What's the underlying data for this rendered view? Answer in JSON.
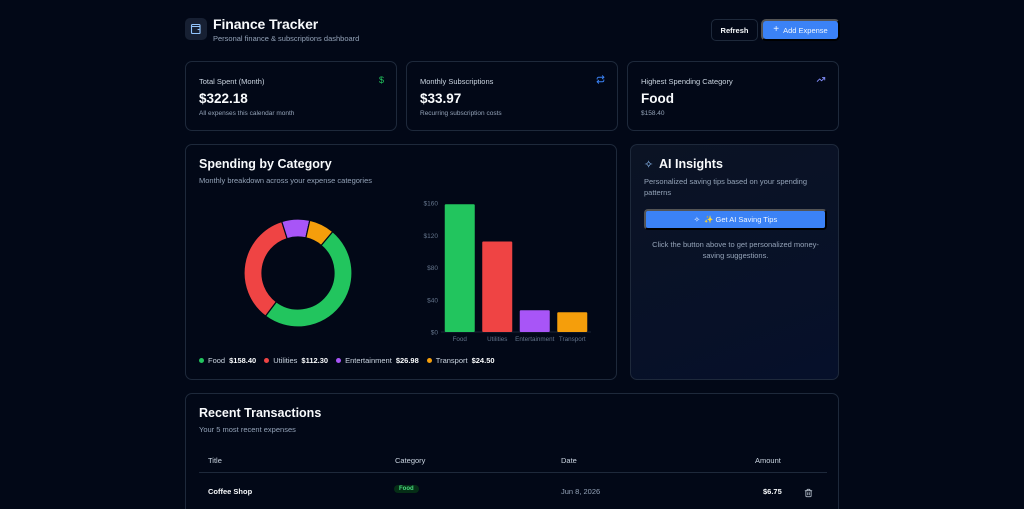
{
  "header": {
    "title": "Finance Tracker",
    "subtitle": "Personal finance & subscriptions dashboard",
    "refresh_label": "Refresh",
    "add_label": "Add Expense"
  },
  "stats": [
    {
      "label": "Total Spent (Month)",
      "value": "$322.18",
      "note": "All expenses this calendar month",
      "icon": "dollar-icon",
      "color": "#22c55e"
    },
    {
      "label": "Monthly Subscriptions",
      "value": "$33.97",
      "note": "Recurring subscription costs",
      "icon": "repeat-icon",
      "color": "#3b82f6"
    },
    {
      "label": "Highest Spending Category",
      "value": "Food",
      "note": "$158.40",
      "icon": "trending-up-icon",
      "color": "#818cf8"
    }
  ],
  "spending": {
    "title": "Spending by Category",
    "subtitle": "Monthly breakdown across your expense categories"
  },
  "chart_data": [
    {
      "type": "pie",
      "categories": [
        "Food",
        "Utilities",
        "Entertainment",
        "Transport"
      ],
      "values": [
        158.4,
        112.3,
        26.98,
        24.5
      ],
      "colors": [
        "#22c55e",
        "#ef4444",
        "#a855f7",
        "#f59e0b"
      ]
    },
    {
      "type": "bar",
      "categories": [
        "Food",
        "Utilities",
        "Entertainment",
        "Transport"
      ],
      "values": [
        158.4,
        112.3,
        26.98,
        24.5
      ],
      "colors": [
        "#22c55e",
        "#ef4444",
        "#a855f7",
        "#f59e0b"
      ],
      "ylim": [
        0,
        160
      ],
      "yticks": [
        "$0",
        "$40",
        "$80",
        "$120",
        "$160"
      ]
    }
  ],
  "legend": [
    {
      "name": "Food",
      "value": "$158.40",
      "color": "#22c55e"
    },
    {
      "name": "Utilities",
      "value": "$112.30",
      "color": "#ef4444"
    },
    {
      "name": "Entertainment",
      "value": "$26.98",
      "color": "#a855f7"
    },
    {
      "name": "Transport",
      "value": "$24.50",
      "color": "#f59e0b"
    }
  ],
  "ai": {
    "title": "AI Insights",
    "subtitle": "Personalized saving tips based on your spending patterns",
    "button_label": "✨ Get AI Saving Tips",
    "note": "Click the button above to get personalized money-saving suggestions."
  },
  "transactions": {
    "title": "Recent Transactions",
    "subtitle": "Your 5 most recent expenses",
    "columns": [
      "Title",
      "Category",
      "Date",
      "Amount"
    ],
    "rows": [
      {
        "title": "Coffee Shop",
        "category": "Food",
        "date": "Jun 8, 2026",
        "amount": "$6.75"
      }
    ]
  }
}
